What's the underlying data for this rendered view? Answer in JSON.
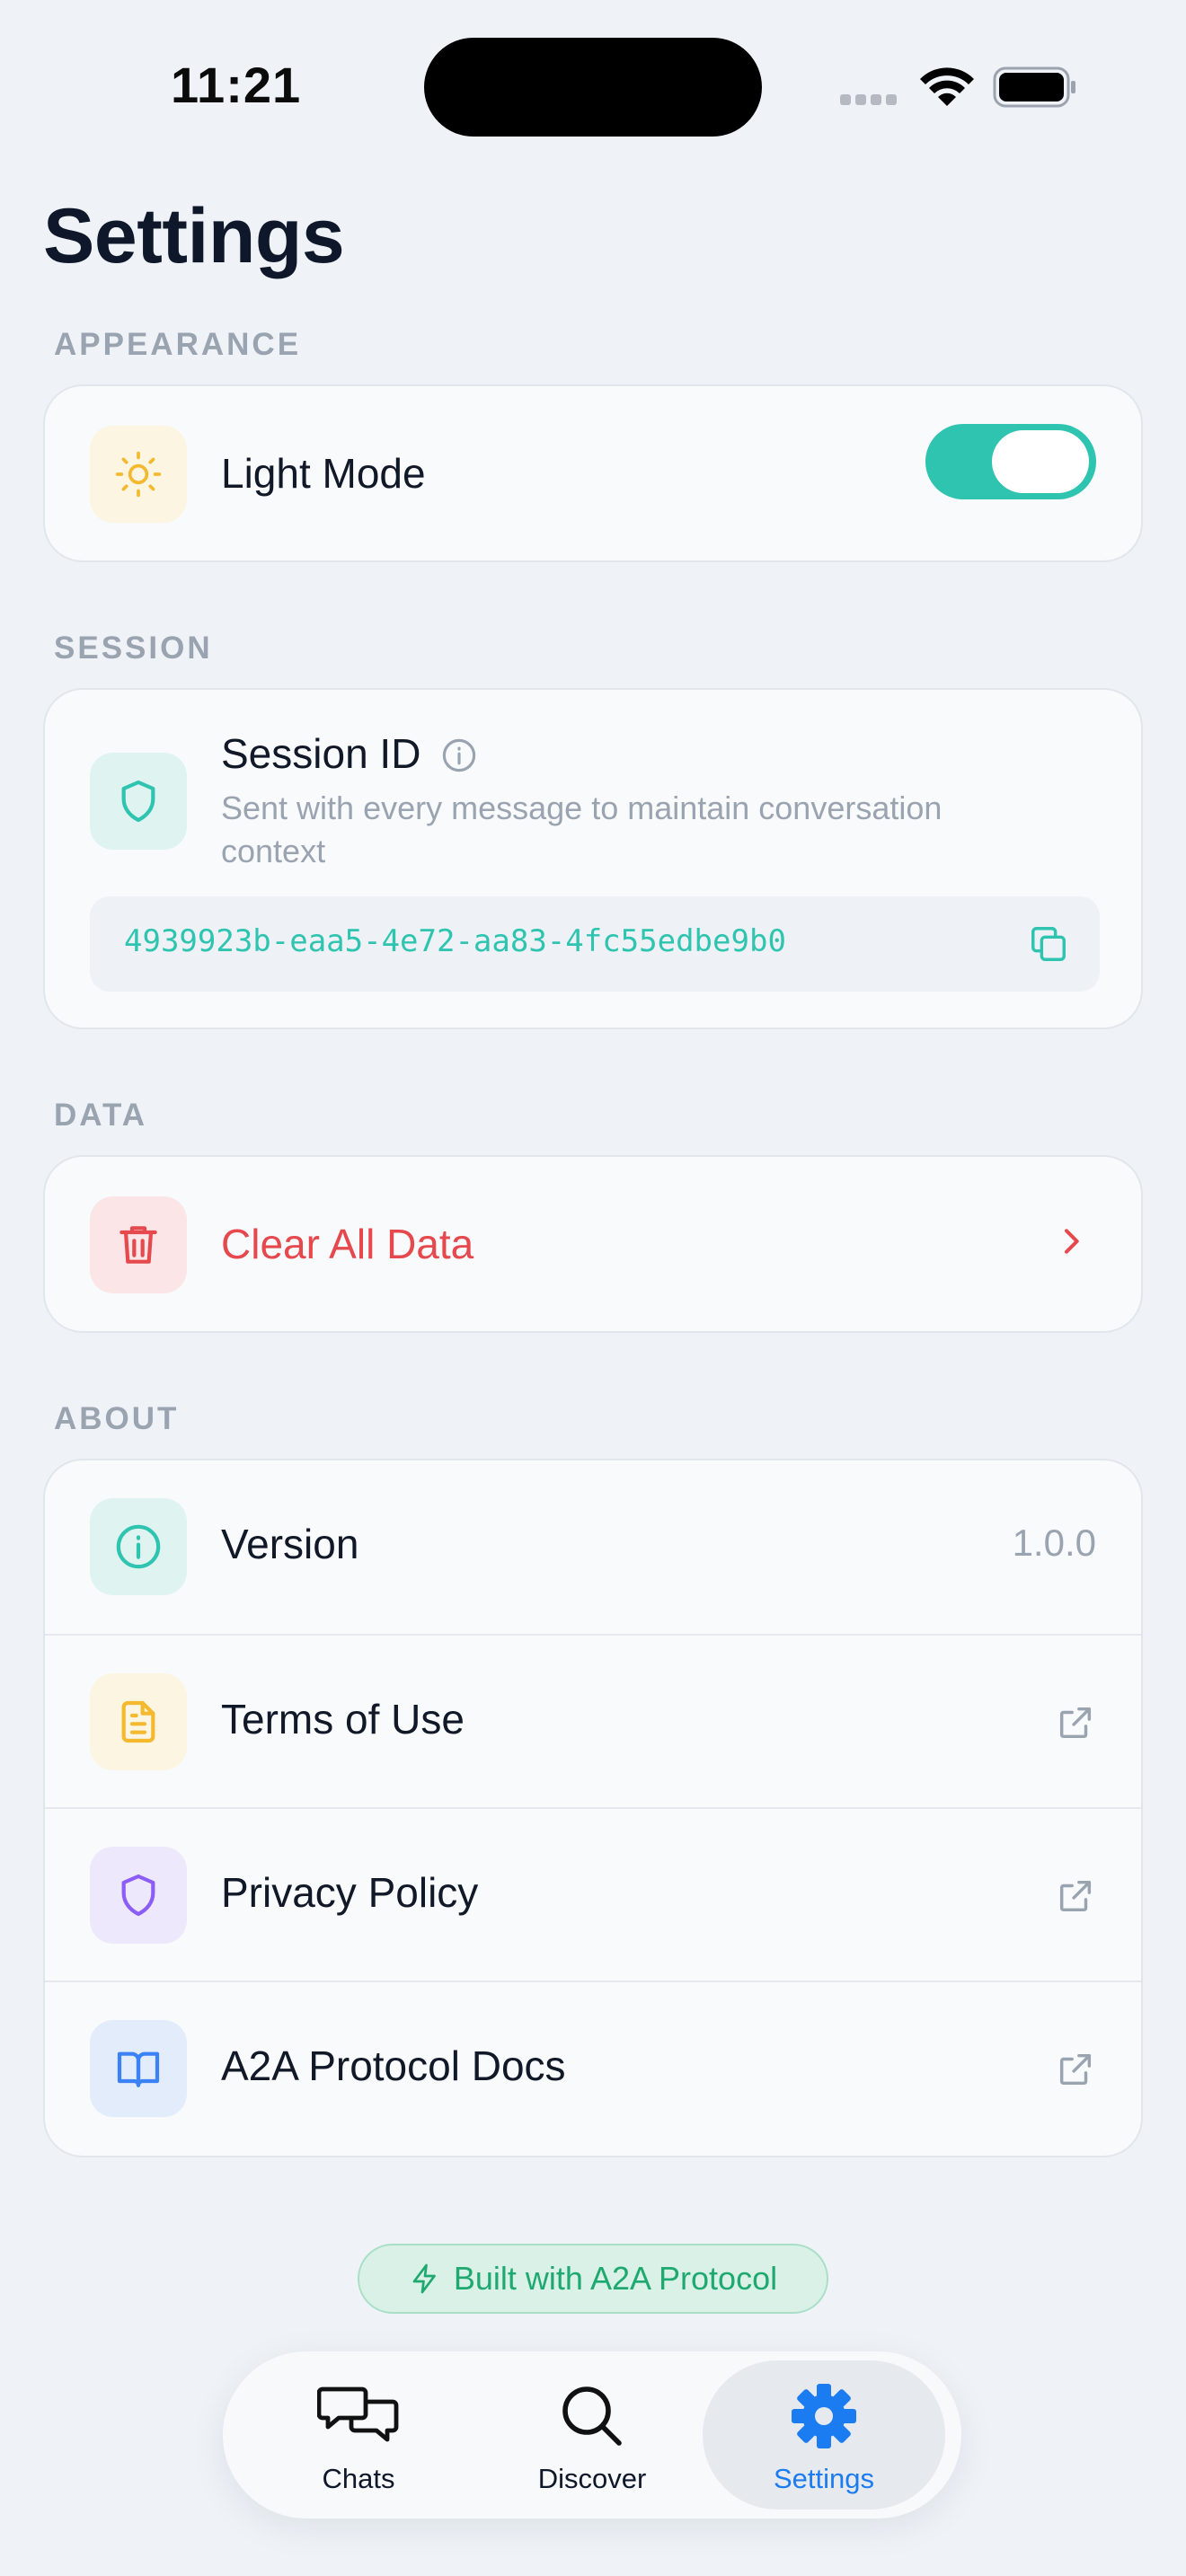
{
  "status_bar": {
    "time": "11:21"
  },
  "page": {
    "title": "Settings"
  },
  "sections": {
    "appearance": {
      "label": "APPEARANCE",
      "row_label": "Light Mode",
      "toggle_on": true
    },
    "session": {
      "label": "SESSION",
      "title": "Session ID",
      "description": "Sent with every message to maintain conversation context",
      "session_id": "4939923b-eaa5-4e72-aa83-4fc55edbe9b0"
    },
    "data": {
      "label": "DATA",
      "row_label": "Clear All Data"
    },
    "about": {
      "label": "ABOUT",
      "rows": [
        {
          "label": "Version",
          "value": "1.0.0",
          "icon": "info-icon"
        },
        {
          "label": "Terms of Use",
          "icon": "document-icon"
        },
        {
          "label": "Privacy Policy",
          "icon": "shield-icon"
        },
        {
          "label": "A2A Protocol Docs",
          "icon": "book-icon"
        }
      ]
    }
  },
  "badge": {
    "text": "Built with A2A Protocol"
  },
  "tab_bar": {
    "tabs": [
      {
        "label": "Chats",
        "icon": "chat-bubbles-icon",
        "active": false
      },
      {
        "label": "Discover",
        "icon": "search-icon",
        "active": false
      },
      {
        "label": "Settings",
        "icon": "gear-icon",
        "active": true
      }
    ]
  },
  "colors": {
    "accent_teal": "#2ec4b0",
    "danger": "#e5484d",
    "tab_active": "#1a7cf0",
    "badge_green": "#1fa971"
  }
}
